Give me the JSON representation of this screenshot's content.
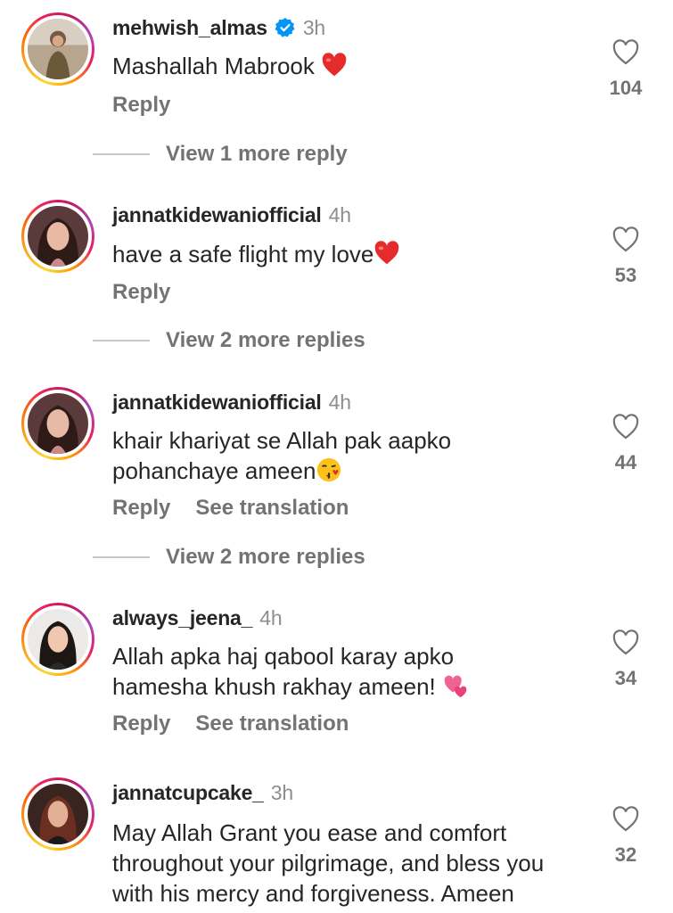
{
  "colors": {
    "primary_text": "#262626",
    "secondary_text": "#737373",
    "verified": "#0095f6",
    "heart": "#ed4956"
  },
  "comments": [
    {
      "username": "mehwish_almas",
      "verified": true,
      "time": "3h",
      "text": "Mashallah Mabrook",
      "emoji": "red-heart",
      "reply_label": "Reply",
      "likes": "104",
      "view_more": "View 1 more reply"
    },
    {
      "username": "jannatkidewaniofficial",
      "verified": false,
      "time": "4h",
      "text": "have a safe flight my love",
      "emoji": "red-heart",
      "reply_label": "Reply",
      "likes": "53",
      "view_more": "View 2 more replies"
    },
    {
      "username": "jannatkidewaniofficial",
      "verified": false,
      "time": "4h",
      "text_line1": "khair khariyat se Allah pak aapko",
      "text_line2": "pohanchaye ameen",
      "emoji": "kissing-face",
      "reply_label": "Reply",
      "translate_label": "See translation",
      "likes": "44",
      "view_more": "View 2 more replies"
    },
    {
      "username": "always_jeena_",
      "verified": false,
      "time": "4h",
      "text_line1": "Allah apka haj qabool karay apko",
      "text_line2": "hamesha khush rakhay ameen!",
      "emoji": "two-hearts",
      "reply_label": "Reply",
      "translate_label": "See translation",
      "likes": "34"
    },
    {
      "username": "jannatcupcake_",
      "verified": false,
      "time": "3h",
      "text_line1": "May Allah Grant you ease and comfort",
      "text_line2": "throughout your pilgrimage, and bless you",
      "text_line3": "with his mercy and forgiveness. Ameen",
      "likes": "32"
    }
  ]
}
